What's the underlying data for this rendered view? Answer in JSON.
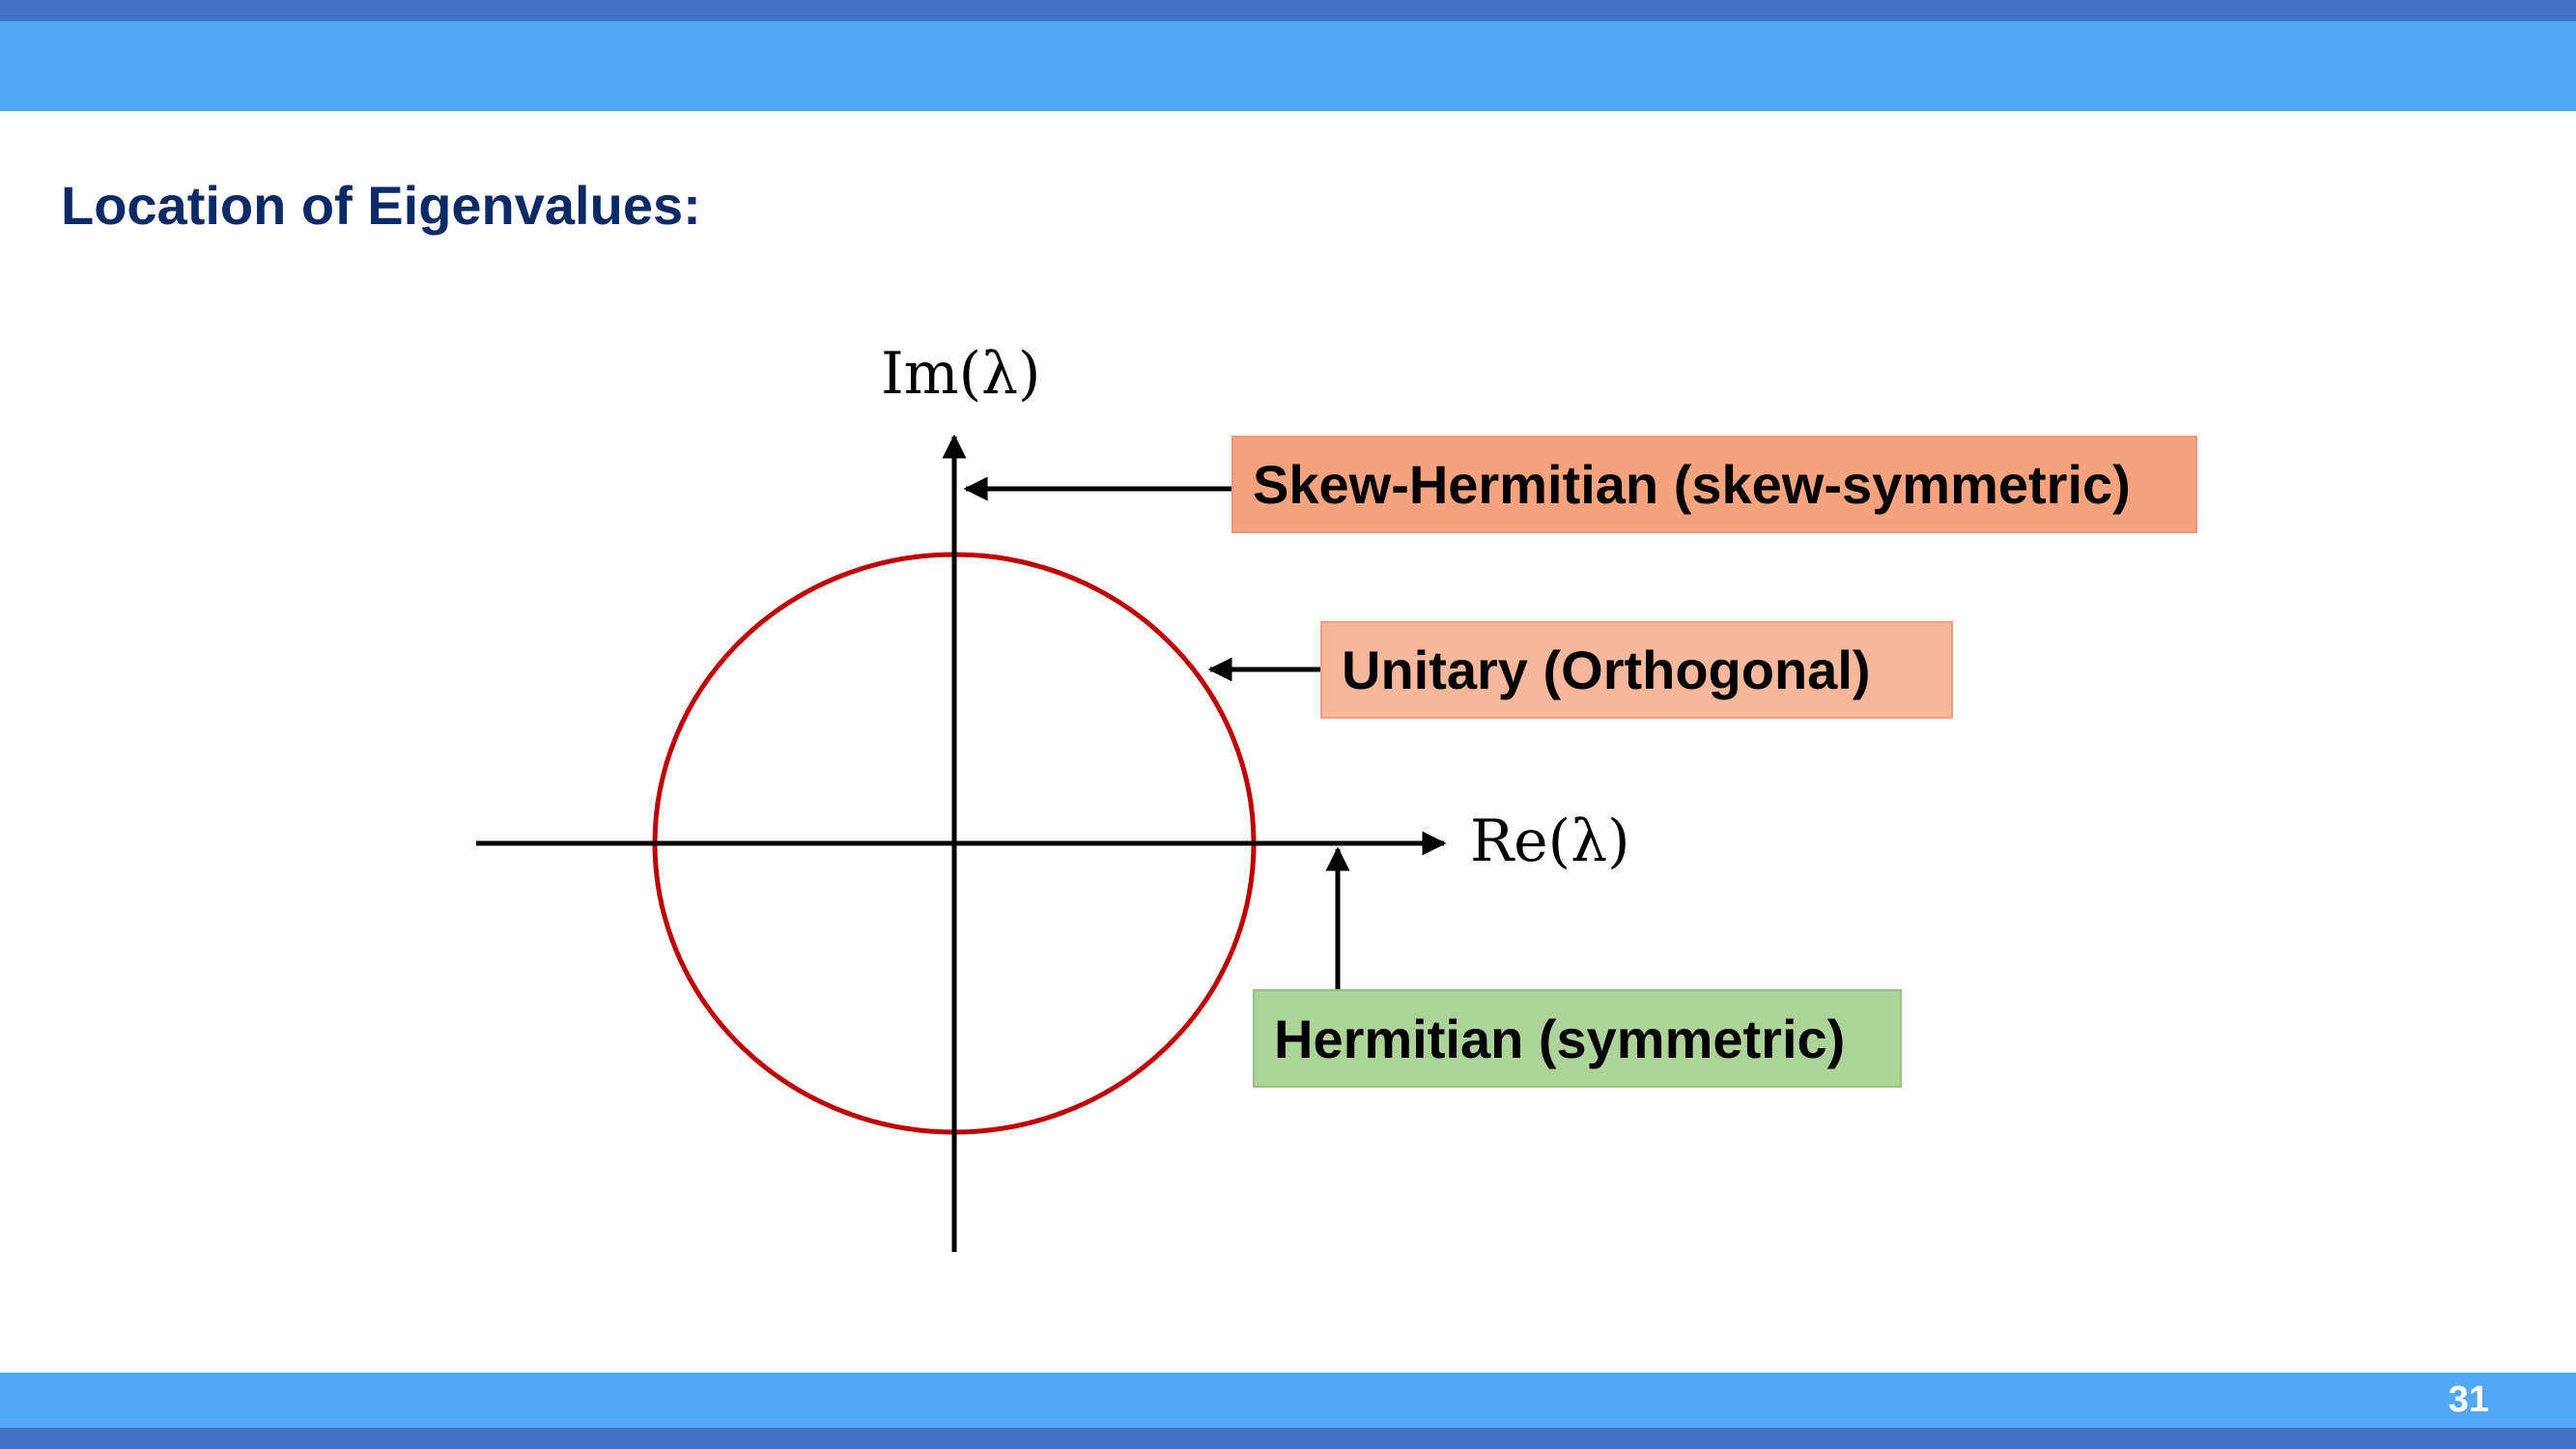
{
  "slide": {
    "title": "Location of Eigenvalues:",
    "page_number": "31"
  },
  "diagram": {
    "axes": {
      "imaginary_label": "Im(λ)",
      "real_label": "Re(λ)"
    },
    "labels": {
      "skew_hermitian": "Skew-Hermitian (skew-symmetric)",
      "unitary": "Unitary (Orthogonal)",
      "hermitian": "Hermitian (symmetric)"
    },
    "colors": {
      "header_bar": "#53a8f5",
      "header_bar_edge": "#4472c4",
      "title_text": "#0c2a66",
      "unit_circle": "#c00000",
      "skew_hermitian_box": "#f5a37f",
      "unitary_box": "#f7b79a",
      "hermitian_box": "#acd39a"
    }
  }
}
